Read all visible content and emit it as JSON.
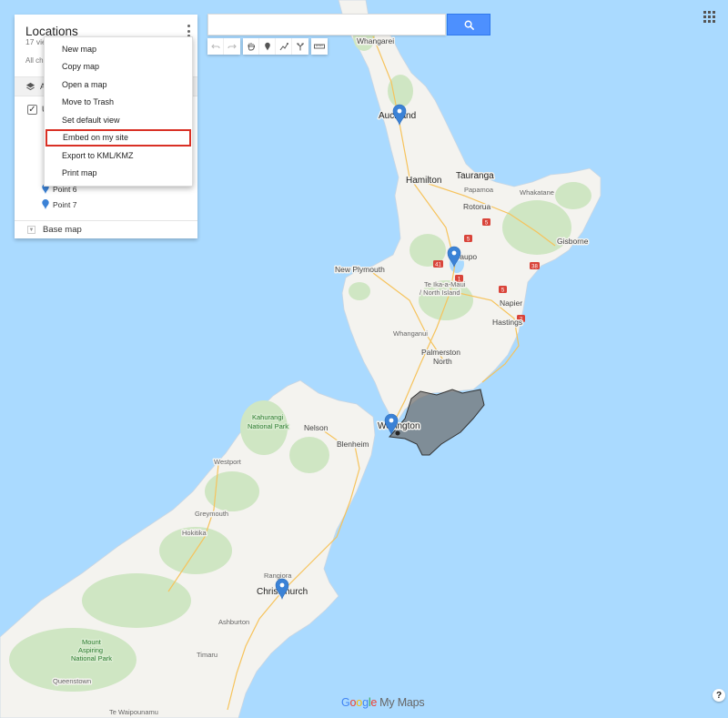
{
  "search": {
    "value": "",
    "placeholder": ""
  },
  "panel": {
    "title": "Locations",
    "views": "17 vie",
    "all_changes": "All ch",
    "layer_label": "A",
    "layer_title_fragment": "U",
    "points": [
      "Point 6",
      "Point 7"
    ],
    "base_map": "Base map"
  },
  "menu": {
    "items": [
      "New map",
      "Copy map",
      "Open a map",
      "Move to Trash",
      "Set default view",
      "Embed on my site",
      "Export to KML/KMZ",
      "Print map"
    ],
    "highlighted_index": 5
  },
  "map": {
    "places": {
      "whangarei": "Whangarei",
      "auckland": "Auckland",
      "tauranga": "Tauranga",
      "hamilton": "Hamilton",
      "papamoa": "Papamoa",
      "whakatane": "Whakatane",
      "rotorua": "Rotorua",
      "taupo": "Taupo",
      "gisborne": "Gisborne",
      "new_plymouth": "New Plymouth",
      "te_ika_1": "Te Ika-a-Maui",
      "te_ika_2": "/ North Island",
      "napier": "Napier",
      "hastings": "Hastings",
      "whanganui": "Whanganui",
      "palmerston_1": "Palmerston",
      "palmerston_2": "North",
      "wellington": "Wellington",
      "kahurangi_1": "Kahurangi",
      "kahurangi_2": "National Park",
      "nelson": "Nelson",
      "blenheim": "Blenheim",
      "westport": "Westport",
      "greymouth": "Greymouth",
      "hokitika": "Hokitika",
      "rangiora": "Rangiora",
      "christchurch": "Christchurch",
      "ashburton": "Ashburton",
      "mt_aspiring_1": "Mount",
      "mt_aspiring_2": "Aspiring",
      "mt_aspiring_3": "National Park",
      "timaru": "Timaru",
      "queenstown": "Queenstown",
      "te_waipounamu": "Te Waipounamu"
    },
    "route_shields": [
      "5",
      "5",
      "41",
      "1",
      "38",
      "2",
      "5"
    ]
  },
  "logo": {
    "g1": "G",
    "o1": "o",
    "o2": "o",
    "g2": "g",
    "l": "l",
    "e": "e",
    "product": "My Maps"
  },
  "help": "?",
  "colors": {
    "water": "#aadaff",
    "land": "#f4f3ef",
    "park": "#cfe6c3",
    "polygon": "#6f6f6f",
    "marker": "#3b82d6",
    "search_button": "#4d90fe",
    "menu_highlight": "#d93025"
  },
  "icons": [
    "search-icon",
    "undo-icon",
    "redo-icon",
    "hand-icon",
    "marker-icon",
    "line-icon",
    "route-icon",
    "ruler-icon",
    "apps-icon",
    "layers-icon",
    "more-vert-icon",
    "help-icon"
  ]
}
